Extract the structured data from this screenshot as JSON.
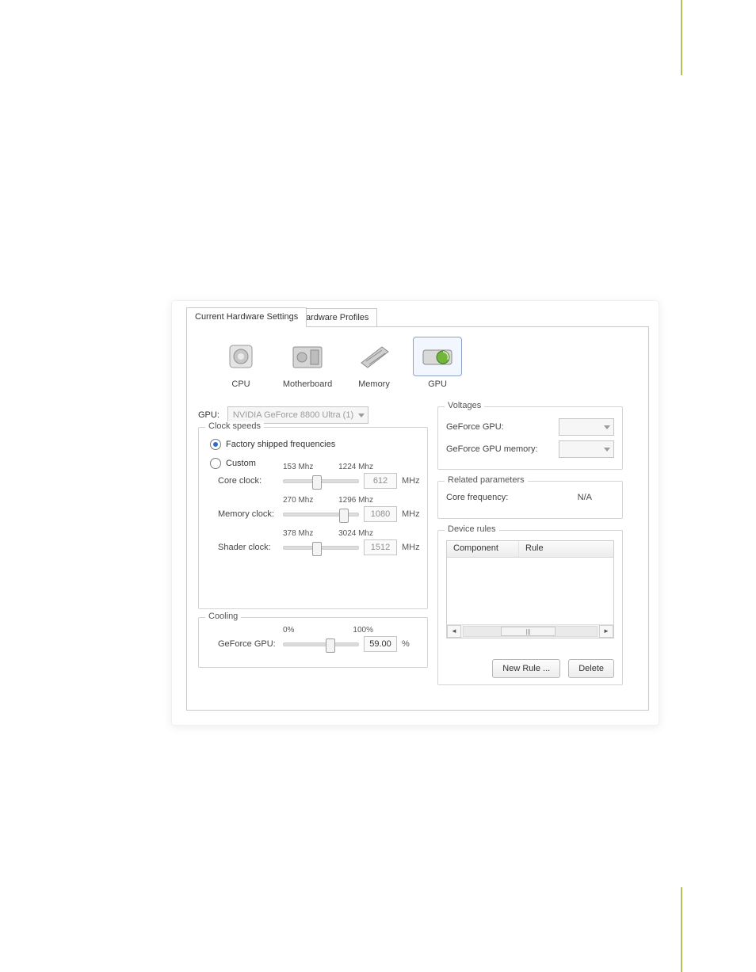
{
  "tabs": {
    "current": "Current Hardware Settings",
    "profiles": "Hardware Profiles"
  },
  "devices": {
    "cpu": "CPU",
    "motherboard": "Motherboard",
    "memory": "Memory",
    "gpu": "GPU"
  },
  "gpu_select": {
    "label": "GPU:",
    "value": "NVIDIA GeForce 8800 Ultra (1)"
  },
  "clock": {
    "legend": "Clock speeds",
    "radio_factory": "Factory shipped frequencies",
    "radio_custom": "Custom",
    "core": {
      "label": "Core clock:",
      "min": "153 Mhz",
      "max": "1224 Mhz",
      "value": "612",
      "unit": "MHz"
    },
    "memory": {
      "label": "Memory clock:",
      "min": "270 Mhz",
      "max": "1296 Mhz",
      "value": "1080",
      "unit": "MHz"
    },
    "shader": {
      "label": "Shader clock:",
      "min": "378 Mhz",
      "max": "3024 Mhz",
      "value": "1512",
      "unit": "MHz"
    }
  },
  "cooling": {
    "legend": "Cooling",
    "label": "GeForce GPU:",
    "min": "0%",
    "max": "100%",
    "value": "59.00",
    "unit": "%"
  },
  "voltages": {
    "legend": "Voltages",
    "gpu_label": "GeForce GPU:",
    "mem_label": "GeForce GPU memory:"
  },
  "related": {
    "legend": "Related parameters",
    "core_freq_label": "Core frequency:",
    "core_freq_value": "N/A"
  },
  "rules": {
    "legend": "Device rules",
    "col_component": "Component",
    "col_rule": "Rule",
    "btn_new": "New Rule ...",
    "btn_delete": "Delete",
    "scroll_grip": "|||"
  }
}
